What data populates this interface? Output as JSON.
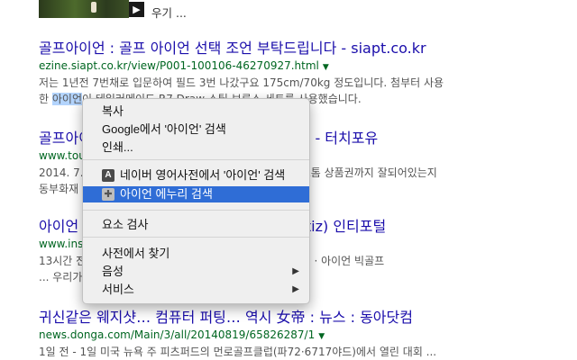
{
  "top_video": {
    "caption": "우기 ..."
  },
  "results": [
    {
      "title": "골프아이언 : 골프 아이언 선택 조언 부탁드립니다 - siapt.co.kr",
      "url": "ezine.siapt.co.kr/view/P001-100106-46270927.html",
      "snippet_line1": "저는 1년전 7번채로 입문하여 필드 3번 나갔구요 175cm/70kg 정도입니다. 첨부터 사용",
      "snippet_line2_pre": "한 ",
      "snippet_highlight": "아이언",
      "snippet_line2_post": "이 테일러메이드 R7 Draw 스틸 브루스 세트를 사용했습니다."
    },
    {
      "title": "골프아이언 골프아이언 고르는법 알려주세요! - 터치포유",
      "url": "www.touchforyou.co.kr",
      "snippet_line1": "2014. 7. ... 골프아이언세트 ... 상품권도 드립니다 · 장마모톰 상품권까지 잘되어있는지",
      "snippet_line2": "동부화재 ... 4대로분기납선납 ..."
    },
    {
      "title": "아이언 에누리 가격비교 추천 - 인스티즈(instiz) 인티포털",
      "url": "www.instiz.net/bbs/list.php?id=name&no=2",
      "snippet_line1": "13시간 전 ... 아이언 에누리 가격비교 :: www.bondisk.co · 아이언 빅골프",
      "snippet_line2": "... 우리가 ... 골프 ... 뻐, 핀, 칼슘, 신규회원 ..."
    },
    {
      "title": "귀신같은 웨지샷… 컴퓨터 퍼팅… 역시 女帝 : 뉴스 : 동아닷컴",
      "url": "news.donga.com/Main/3/all/20140819/65826287/1",
      "snippet_line1": "1일 전 - 1일 미국 뉴욕 주 피츠퍼드의 먼로골프클럽(파72·6717야드)에서 열린 대회 ..."
    }
  ],
  "context_menu": {
    "items": [
      {
        "label": "복사"
      },
      {
        "label": "Google에서 '아이언' 검색"
      },
      {
        "label": "인쇄..."
      },
      {
        "label": "네이버 영어사전에서 '아이언' 검색",
        "icon": "dictionary-icon",
        "icon_glyph": "A"
      },
      {
        "label": "아이언 에누리 검색",
        "icon": "extension-puzzle-icon",
        "icon_glyph": "✚"
      },
      {
        "label": "요소 검사"
      },
      {
        "label": "사전에서 찾기"
      },
      {
        "label": "음성"
      },
      {
        "label": "서비스"
      }
    ],
    "submenu_arrow": "▶"
  },
  "colors": {
    "title_link": "#1a0dab",
    "url_green": "#006621",
    "snippet": "#545454",
    "menu_highlight": "#2f6dd6",
    "selection": "#b3d4fd"
  }
}
